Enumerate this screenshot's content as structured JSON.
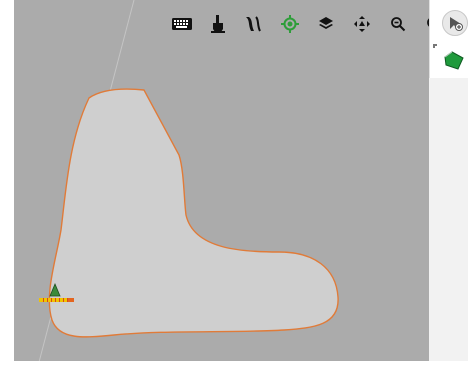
{
  "toolbar": {
    "buttons": [
      {
        "name": "keyboard-icon"
      },
      {
        "name": "hand-pointer-icon"
      },
      {
        "name": "swath-lines-icon"
      },
      {
        "name": "gps-locate-icon",
        "active": true
      },
      {
        "name": "layers-icon"
      },
      {
        "name": "pan-arrows-icon"
      },
      {
        "name": "zoom-out-icon"
      },
      {
        "name": "zoom-in-icon"
      }
    ]
  },
  "side_panel": {
    "toggle_icon": "expand-panel-icon",
    "layer_icon": "field-boundary-icon"
  },
  "colors": {
    "map_background": "#ababab",
    "field_fill": "#cfcfcf",
    "field_border": "#e07b39",
    "gps_active": "#2e9e3a",
    "layer_green": "#1f9a3c",
    "implement_yellow": "#f0c400",
    "implement_red": "#d94a1a"
  }
}
